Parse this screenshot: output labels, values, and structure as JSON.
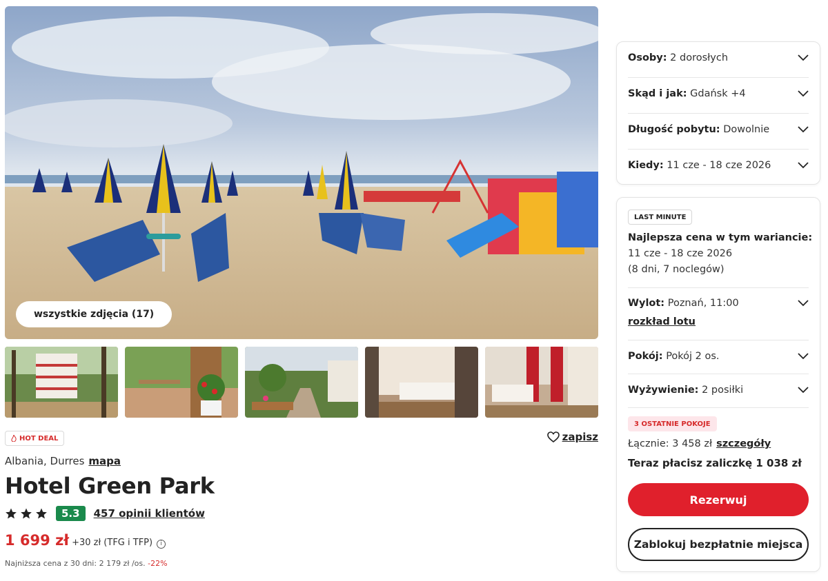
{
  "gallery": {
    "all_photos_label": "wszystkie zdjęcia (17)"
  },
  "hotel": {
    "hot_deal_label": "HOT DEAL",
    "save_label": "zapisz",
    "location": "Albania, Durres",
    "map_label": "mapa",
    "name": "Hotel Green Park",
    "stars": 3,
    "score": "5.3",
    "reviews_label": "457 opinii klientów",
    "price": "1 699 zł",
    "price_extra": "+30 zł (TFG i TFP)",
    "lowest_text": "Najniższa cena z 30 dni: 2 179 zł /os.",
    "lowest_discount": "-22%"
  },
  "filters": {
    "persons": {
      "label": "Osoby:",
      "value": "2 dorosłych"
    },
    "from": {
      "label": "Skąd i jak:",
      "value": "Gdańsk +4"
    },
    "length": {
      "label": "Długość pobytu:",
      "value": "Dowolnie"
    },
    "when": {
      "label": "Kiedy:",
      "value": "11 cze - 18 cze 2026"
    }
  },
  "offer": {
    "badge": "LAST MINUTE",
    "best_title": "Najlepsza cena w tym wariancie:",
    "best_dates": "11 cze - 18 cze 2026",
    "best_nights": "(8 dni, 7 noclegów)",
    "flight": {
      "label": "Wylot:",
      "value": "Poznań, 11:00"
    },
    "flight_link": "rozkład lotu",
    "room": {
      "label": "Pokój:",
      "value": "Pokój 2 os."
    },
    "board": {
      "label": "Wyżywienie:",
      "value": "2 posiłki"
    },
    "rooms_left": "3 OSTATNIE POKOJE",
    "total_text": "Łącznie: 3 458 zł",
    "details_label": "szczegóły",
    "deposit_text": "Teraz płacisz zaliczkę 1 038 zł",
    "book_button": "Rezerwuj",
    "block_button": "Zablokuj bezpłatnie miejsca"
  },
  "colors": {
    "accent_red": "#e0202c",
    "score_green": "#1a8a4c"
  }
}
